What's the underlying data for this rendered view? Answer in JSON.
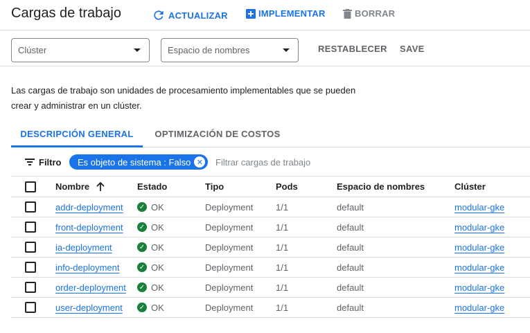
{
  "header": {
    "title": "Cargas de trabajo",
    "refresh_label": "ACTUALIZAR",
    "deploy_label": "IMPLEMENTAR",
    "delete_label": "BORRAR"
  },
  "filters": {
    "cluster_placeholder": "Clúster",
    "namespace_placeholder": "Espacio de nombres",
    "reset_label": "RESTABLECER",
    "save_label": "SAVE"
  },
  "description": "Las cargas de trabajo son unidades de procesamiento implementables que se pueden crear y administrar en un clúster.",
  "tabs": [
    {
      "label": "DESCRIPCIÓN GENERAL",
      "active": true
    },
    {
      "label": "OPTIMIZACIÓN DE COSTOS",
      "active": false
    }
  ],
  "filterbar": {
    "label": "Filtro",
    "chip": "Es objeto de sistema : Falso",
    "placeholder": "Filtrar cargas de trabajo"
  },
  "table": {
    "headers": [
      "Nombre",
      "Estado",
      "Tipo",
      "Pods",
      "Espacio de nombres",
      "Clúster"
    ],
    "rows": [
      {
        "name": "addr-deployment",
        "status": "OK",
        "type": "Deployment",
        "pods": "1/1",
        "namespace": "default",
        "cluster": "modular-gke"
      },
      {
        "name": "front-deployment",
        "status": "OK",
        "type": "Deployment",
        "pods": "1/1",
        "namespace": "default",
        "cluster": "modular-gke"
      },
      {
        "name": "ia-deployment",
        "status": "OK",
        "type": "Deployment",
        "pods": "1/1",
        "namespace": "default",
        "cluster": "modular-gke"
      },
      {
        "name": "info-deployment",
        "status": "OK",
        "type": "Deployment",
        "pods": "1/1",
        "namespace": "default",
        "cluster": "modular-gke"
      },
      {
        "name": "order-deployment",
        "status": "OK",
        "type": "Deployment",
        "pods": "1/1",
        "namespace": "default",
        "cluster": "modular-gke"
      },
      {
        "name": "user-deployment",
        "status": "OK",
        "type": "Deployment",
        "pods": "1/1",
        "namespace": "default",
        "cluster": "modular-gke"
      }
    ]
  },
  "colors": {
    "accent": "#1a73e8",
    "ok": "#188038",
    "muted": "#5f6368",
    "divider": "#dadce0"
  }
}
